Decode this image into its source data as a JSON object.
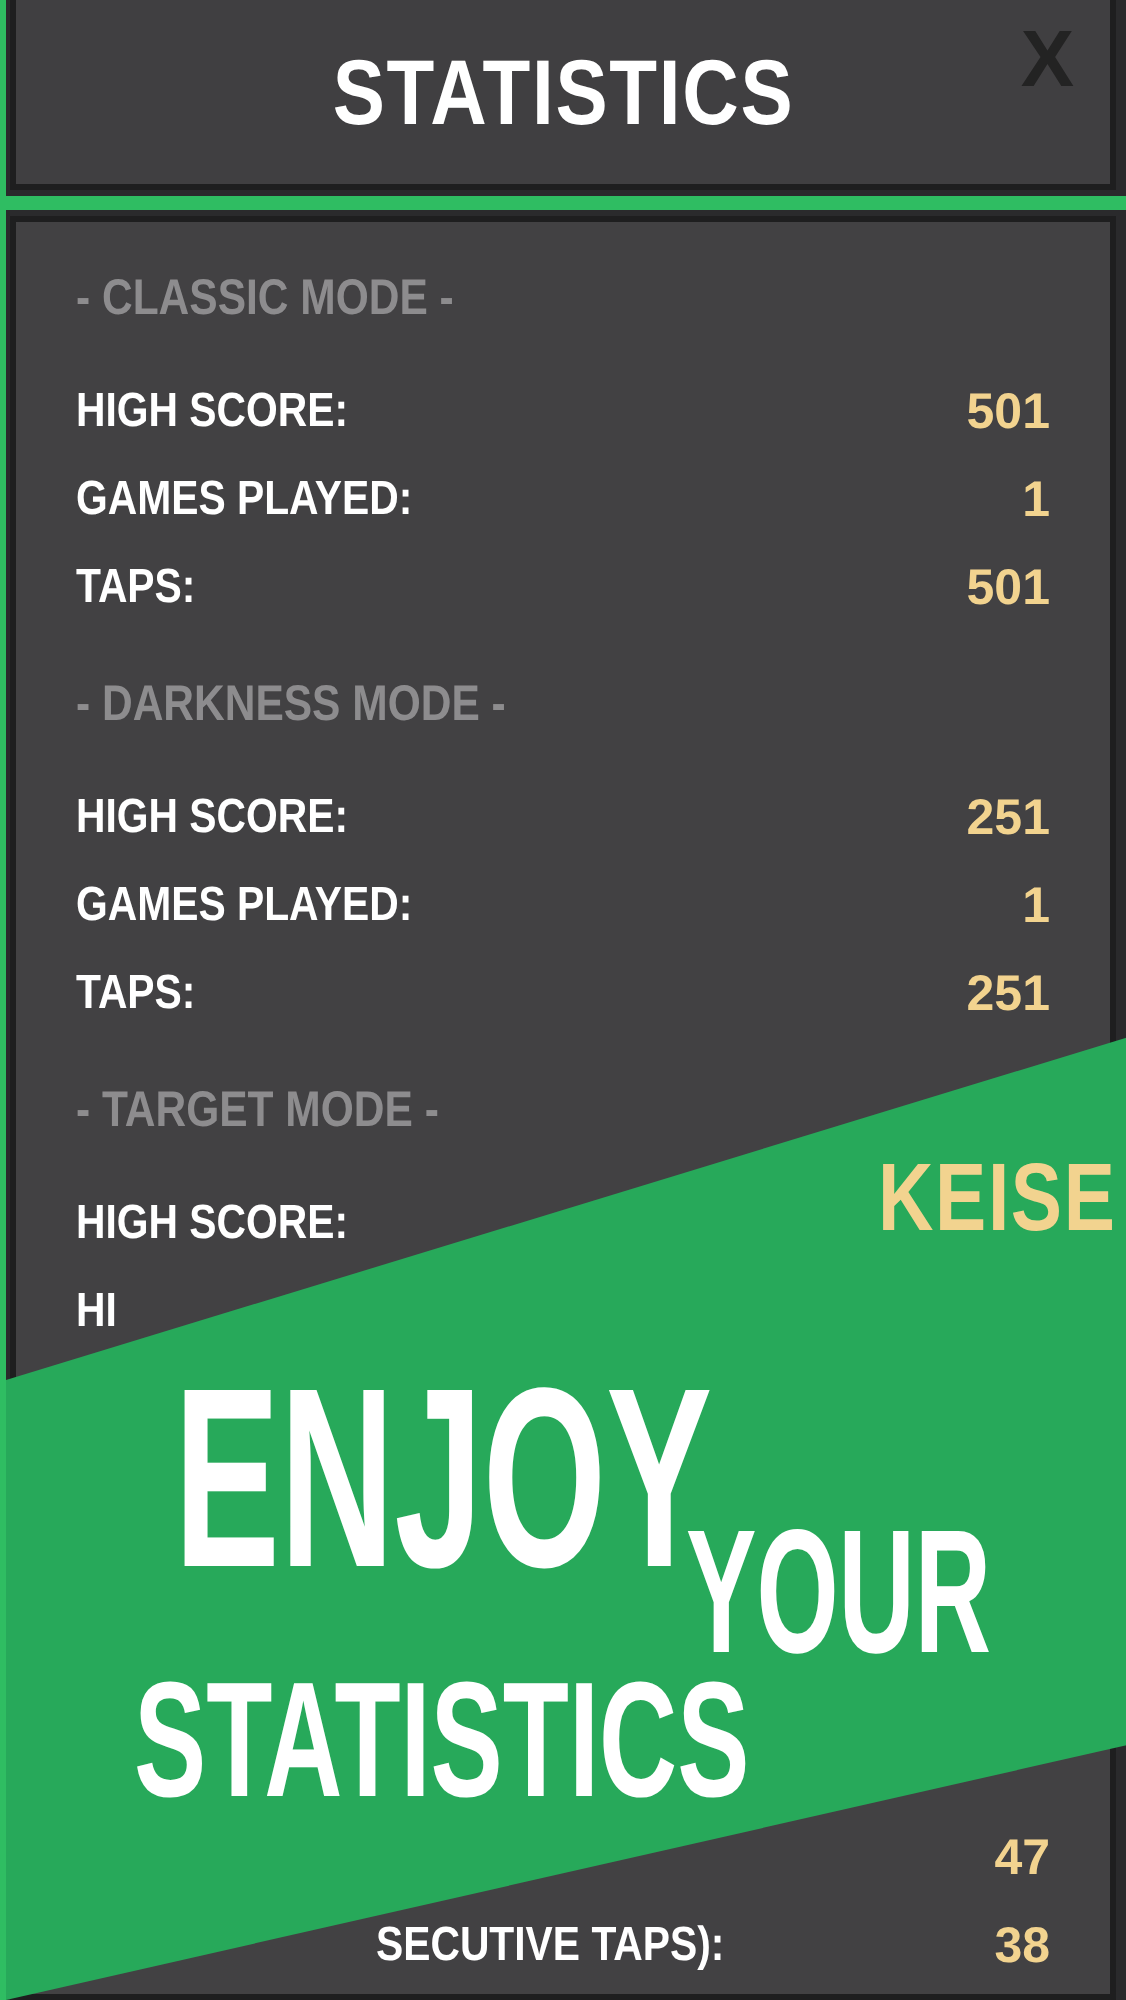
{
  "header": {
    "title": "STATISTICS",
    "close": "X"
  },
  "sections": [
    {
      "title": "- CLASSIC MODE -",
      "rows": [
        {
          "label": "HIGH SCORE:",
          "value": "501"
        },
        {
          "label": "GAMES PLAYED:",
          "value": "1"
        },
        {
          "label": "TAPS:",
          "value": "501"
        }
      ]
    },
    {
      "title": "- DARKNESS MODE -",
      "rows": [
        {
          "label": "HIGH SCORE:",
          "value": "251"
        },
        {
          "label": "GAMES PLAYED:",
          "value": "1"
        },
        {
          "label": "TAPS:",
          "value": "251"
        }
      ]
    },
    {
      "title": "- TARGET MODE -",
      "rows": [
        {
          "label": "HIGH SCORE:"
        },
        {
          "label": "HI"
        }
      ]
    }
  ],
  "tail_rows": [
    {
      "value": "47"
    },
    {
      "label": "SECUTIVE TAPS):",
      "value": "38"
    }
  ],
  "banner": {
    "brand": "KEISE",
    "headline": [
      "ENJOY",
      "YOUR",
      "STATISTICS"
    ]
  }
}
